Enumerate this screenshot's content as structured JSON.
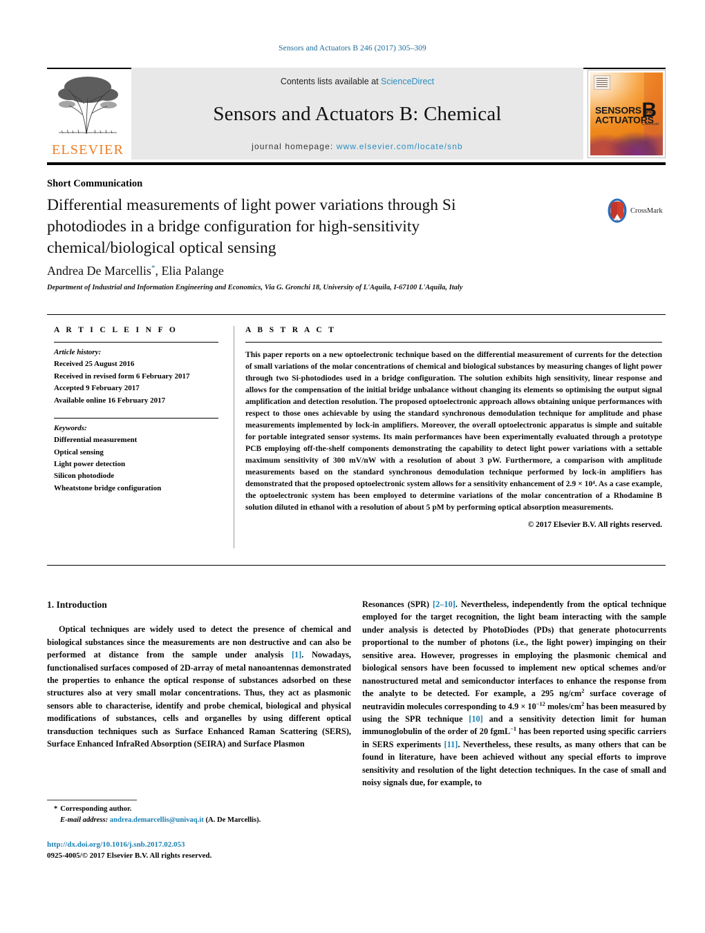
{
  "running_head": "Sensors and Actuators B 246 (2017) 305–309",
  "masthead": {
    "contents_prefix": "Contents lists available at",
    "contents_link": "ScienceDirect",
    "journal_title": "Sensors and Actuators B: Chemical",
    "homepage_label": "journal homepage:",
    "homepage_url": "www.elsevier.com/locate/snb",
    "publisher_wordmark": "ELSEVIER",
    "publisher_logo_icon": "elsevier-tree-icon",
    "cover": {
      "line1": "SENSORS",
      "line1_small": "and",
      "line2": "ACTUATORS",
      "letter": "B",
      "letter_sub": "Chemical"
    },
    "accent_link_color": "#2b8cbe",
    "brand_orange": "#ef7d22"
  },
  "article": {
    "kind": "Short Communication",
    "title": "Differential measurements of light power variations through Si photodiodes in a bridge configuration for high-sensitivity chemical/biological optical sensing",
    "authors_plain": "Andrea De Marcellis",
    "authors_rest": ", Elia Palange",
    "corresponding_marker": "*",
    "affiliation": "Department of Industrial and Information Engineering and Economics, Via G. Gronchi 18, University of L'Aquila, I-67100 L'Aquila, Italy",
    "crossmark": {
      "label": "CrossMark",
      "icon": "crossmark-badge-icon"
    }
  },
  "article_info": {
    "heading": "A R T I C L E  I N F O",
    "history_label": "Article history:",
    "history": [
      "Received 25 August 2016",
      "Received in revised form 6 February 2017",
      "Accepted 9 February 2017",
      "Available online 16 February 2017"
    ],
    "keywords_label": "Keywords:",
    "keywords": [
      "Differential measurement",
      "Optical sensing",
      "Light power detection",
      "Silicon photodiode",
      "Wheatstone bridge configuration"
    ]
  },
  "abstract": {
    "heading": "A B S T R A C T",
    "text": "This paper reports on a new optoelectronic technique based on the differential measurement of currents for the detection of small variations of the molar concentrations of chemical and biological substances by measuring changes of light power through two Si-photodiodes used in a bridge configuration. The solution exhibits high sensitivity, linear response and allows for the compensation of the initial bridge unbalance without changing its elements so optimising the output signal amplification and detection resolution. The proposed optoelectronic approach allows obtaining unique performances with respect to those ones achievable by using the standard synchronous demodulation technique for amplitude and phase measurements implemented by lock-in amplifiers. Moreover, the overall optoelectronic apparatus is simple and suitable for portable integrated sensor systems. Its main performances have been experimentally evaluated through a prototype PCB employing off-the-shelf components demonstrating the capability to detect light power variations with a settable maximum sensitivity of 300 mV/nW with a resolution of about 3 pW. Furthermore, a comparison with amplitude measurements based on the standard synchronous demodulation technique performed by lock-in amplifiers has demonstrated that the proposed optoelectronic system allows for a sensitivity enhancement of 2.9 × 10⁴. As a case example, the optoelectronic system has been employed to determine variations of the molar concentration of a Rhodamine B solution diluted in ethanol with a resolution of about 5 pM by performing optical absorption measurements.",
    "copyright": "© 2017 Elsevier B.V. All rights reserved."
  },
  "body": {
    "section_number_title": "1.  Introduction",
    "left_paragraph_parts": {
      "p1a": "Optical techniques are widely used to detect the presence of chemical and biological substances since the measurements are non destructive and can also be performed at distance from the sample under analysis ",
      "ref1": "[1]",
      "p1b": ". Nowadays, functionalised surfaces composed of 2D-array of metal nanoantennas demonstrated the properties to enhance the optical response of substances adsorbed on these structures also at very small molar concentrations. Thus, they act as plasmonic sensors able to characterise, identify and probe chemical, biological and physical modifications of substances, cells and organelles by using different optical transduction techniques such as Surface Enhanced Raman Scattering (SERS), Surface Enhanced InfraRed Absorption (SEIRA) and Surface Plasmon"
    },
    "right_paragraph_parts": {
      "p2a": "Resonances (SPR) ",
      "ref2": "[2–10]",
      "p2b": ". Nevertheless, independently from the optical technique employed for the target recognition, the light beam interacting with the sample under analysis is detected by PhotoDiodes (PDs) that generate photocurrents proportional to the number of photons (i.e., the light power) impinging on their sensitive area. However, progresses in employing the plasmonic chemical and biological sensors have been focussed to implement new optical schemes and/or nanostructured metal and semiconductor interfaces to enhance the response from the analyte to be detected. For example, a 295 ng/cm",
      "sup1": "2",
      "p2c": " surface coverage of neutravidin molecules corresponding to 4.9 × 10",
      "sup2": "−12",
      "p2d": " moles/cm",
      "sup3": "2",
      "p2e": " has been measured by using the SPR technique ",
      "ref3": "[10]",
      "p2f": " and a sensitivity detection limit for human immunoglobulin of the order of 20 fgmL",
      "sup4": "−1",
      "p2g": " has been reported using specific carriers in SERS experiments ",
      "ref4": "[11]",
      "p2h": ". Nevertheless, these results, as many others that can be found in literature, have been achieved without any special efforts to improve sensitivity and resolution of the light detection techniques. In the case of small and noisy signals due, for example, to"
    }
  },
  "footer": {
    "corresponding_label": "Corresponding author.",
    "email_label": "E-mail address:",
    "email": "andrea.demarcellis@univaq.it",
    "email_suffix": "(A. De Marcellis).",
    "doi": "http://dx.doi.org/10.1016/j.snb.2017.02.053",
    "issn_line": "0925-4005/© 2017 Elsevier B.V. All rights reserved."
  }
}
